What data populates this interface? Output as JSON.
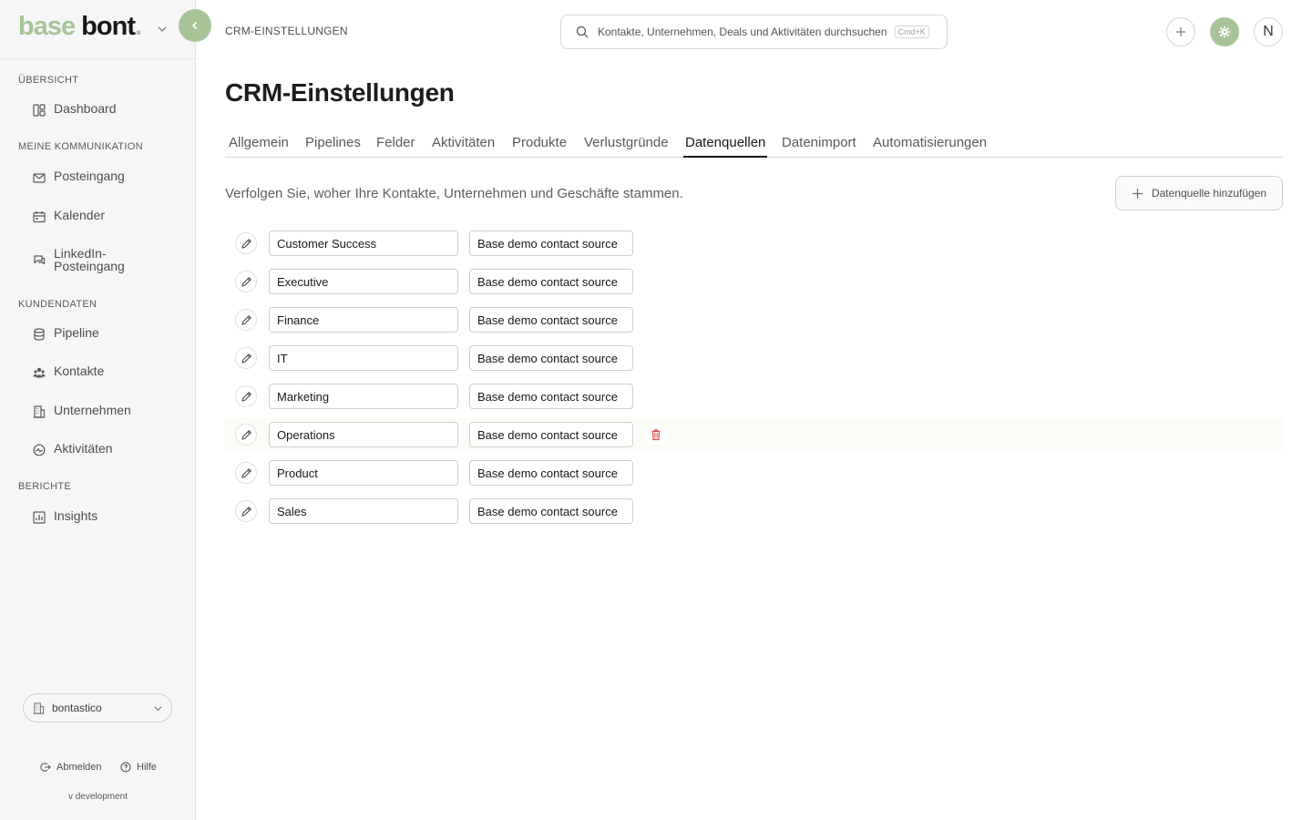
{
  "brand": {
    "part1": "base",
    "part2": "bont",
    "dot": "."
  },
  "sidebar": {
    "sections": [
      {
        "label": "Übersicht",
        "items": [
          {
            "label": "Dashboard",
            "icon": "dashboard-icon"
          }
        ]
      },
      {
        "label": "Meine Kommunikation",
        "items": [
          {
            "label": "Posteingang",
            "icon": "mail-icon"
          },
          {
            "label": "Kalender",
            "icon": "calendar-icon"
          },
          {
            "label": "LinkedIn-Posteingang",
            "icon": "chat-icon"
          }
        ]
      },
      {
        "label": "Kundendaten",
        "items": [
          {
            "label": "Pipeline",
            "icon": "database-icon"
          },
          {
            "label": "Kontakte",
            "icon": "contacts-icon"
          },
          {
            "label": "Unternehmen",
            "icon": "building-icon"
          },
          {
            "label": "Aktivitäten",
            "icon": "activity-icon"
          }
        ]
      },
      {
        "label": "Berichte",
        "items": [
          {
            "label": "Insights",
            "icon": "chart-icon"
          }
        ]
      }
    ],
    "org": "bontastico",
    "logout": "Abmelden",
    "help": "Hilfe",
    "version": "v development"
  },
  "header": {
    "breadcrumb": "CRM-EINSTELLUNGEN",
    "search_placeholder": "Kontakte, Unternehmen, Deals und Aktivitäten durchsuchen",
    "search_shortcut": "Cmd+K",
    "avatar_initial": "N"
  },
  "main": {
    "title": "CRM-Einstellungen",
    "tabs": [
      {
        "label": "Allgemein"
      },
      {
        "label": "Pipelines"
      },
      {
        "label": "Felder"
      },
      {
        "label": "Aktivitäten"
      },
      {
        "label": "Produkte"
      },
      {
        "label": "Verlustgründe"
      },
      {
        "label": "Datenquellen",
        "active": true
      },
      {
        "label": "Datenimport"
      },
      {
        "label": "Automatisierungen"
      }
    ],
    "description": "Verfolgen Sie, woher Ihre Kontakte, Unternehmen und Geschäfte stammen.",
    "add_button": "Datenquelle hinzufügen",
    "sources": [
      {
        "name": "Customer Success",
        "source": "Base demo contact source"
      },
      {
        "name": "Executive",
        "source": "Base demo contact source"
      },
      {
        "name": "Finance",
        "source": "Base demo contact source"
      },
      {
        "name": "IT",
        "source": "Base demo contact source"
      },
      {
        "name": "Marketing",
        "source": "Base demo contact source"
      },
      {
        "name": "Operations",
        "source": "Base demo contact source"
      },
      {
        "name": "Product",
        "source": "Base demo contact source"
      },
      {
        "name": "Sales",
        "source": "Base demo contact source"
      }
    ]
  },
  "colors": {
    "accent": "#a7c497",
    "danger": "#e0484b",
    "text": "#1f2328",
    "sidebar_bg": "#f6f6f6"
  }
}
